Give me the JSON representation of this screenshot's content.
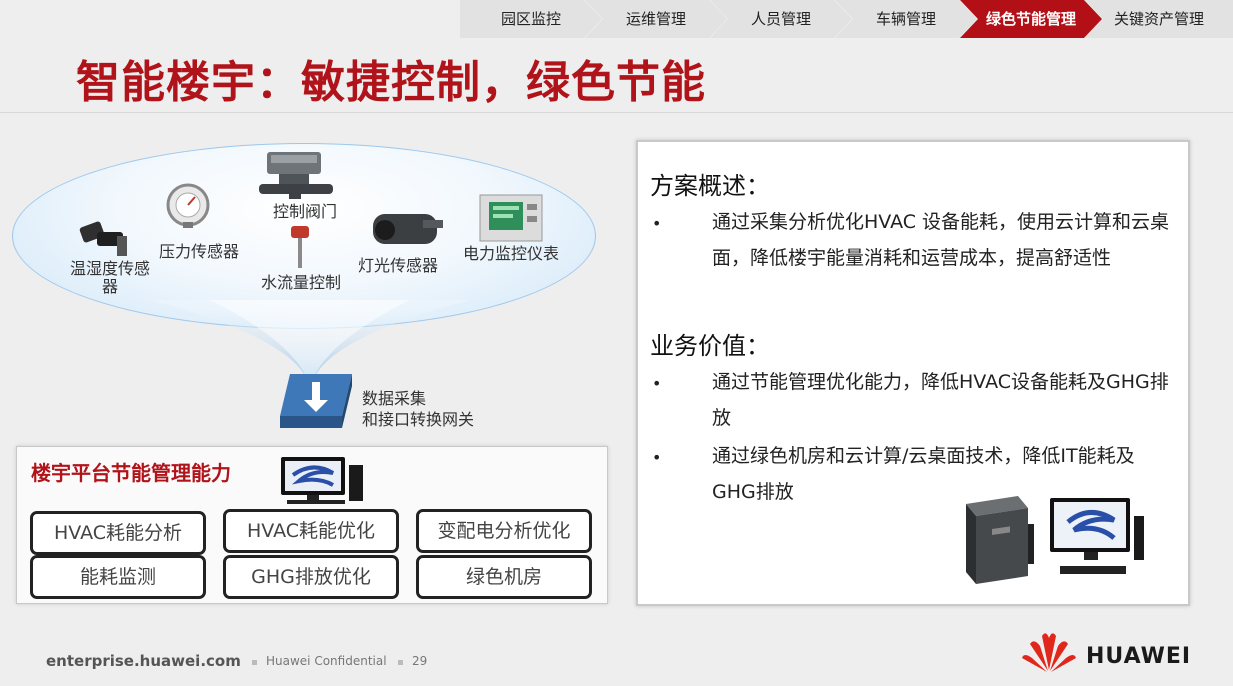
{
  "nav": {
    "items": [
      "园区监控",
      "运维管理",
      "人员管理",
      "车辆管理",
      "绿色节能管理",
      "关键资产管理"
    ],
    "active_index": 4,
    "active_color": "#b30f16"
  },
  "title": "智能楼宇：敏捷控制，绿色节能",
  "sensors": {
    "control_valve": "控制阀门",
    "pressure_sensor": "压力传感器",
    "temp_humidity_sensor": "温湿度传感器",
    "water_flow_control": "水流量控制",
    "light_sensor": "灯光传感器",
    "power_meter": "电力监控仪表"
  },
  "gateway": {
    "line1": "数据采集",
    "line2": "和接口转换网关"
  },
  "platform": {
    "title": "楼宇平台节能管理能力",
    "capabilities": [
      "HVAC耗能分析",
      "HVAC耗能优化",
      "变配电分析优化",
      "能耗监测",
      "GHG排放优化",
      "绿色机房"
    ]
  },
  "panel": {
    "overview_title": "方案概述：",
    "overview_bullet": "通过采集分析优化HVAC 设备能耗，使用云计算和云桌面，降低楼宇能量消耗和运营成本，提高舒适性",
    "value_title": "业务价值：",
    "value_bullets": [
      "通过节能管理优化能力，降低HVAC设备能耗及GHG排放",
      "通过绿色机房和云计算/云桌面技术，降低IT能耗及GHG排放"
    ],
    "bullet_char": "•"
  },
  "footer": {
    "site": "enterprise.huawei.com",
    "confidential": "Huawei Confidential",
    "page": "29",
    "brand": "HUAWEI",
    "brand_color": "#e1261c"
  }
}
